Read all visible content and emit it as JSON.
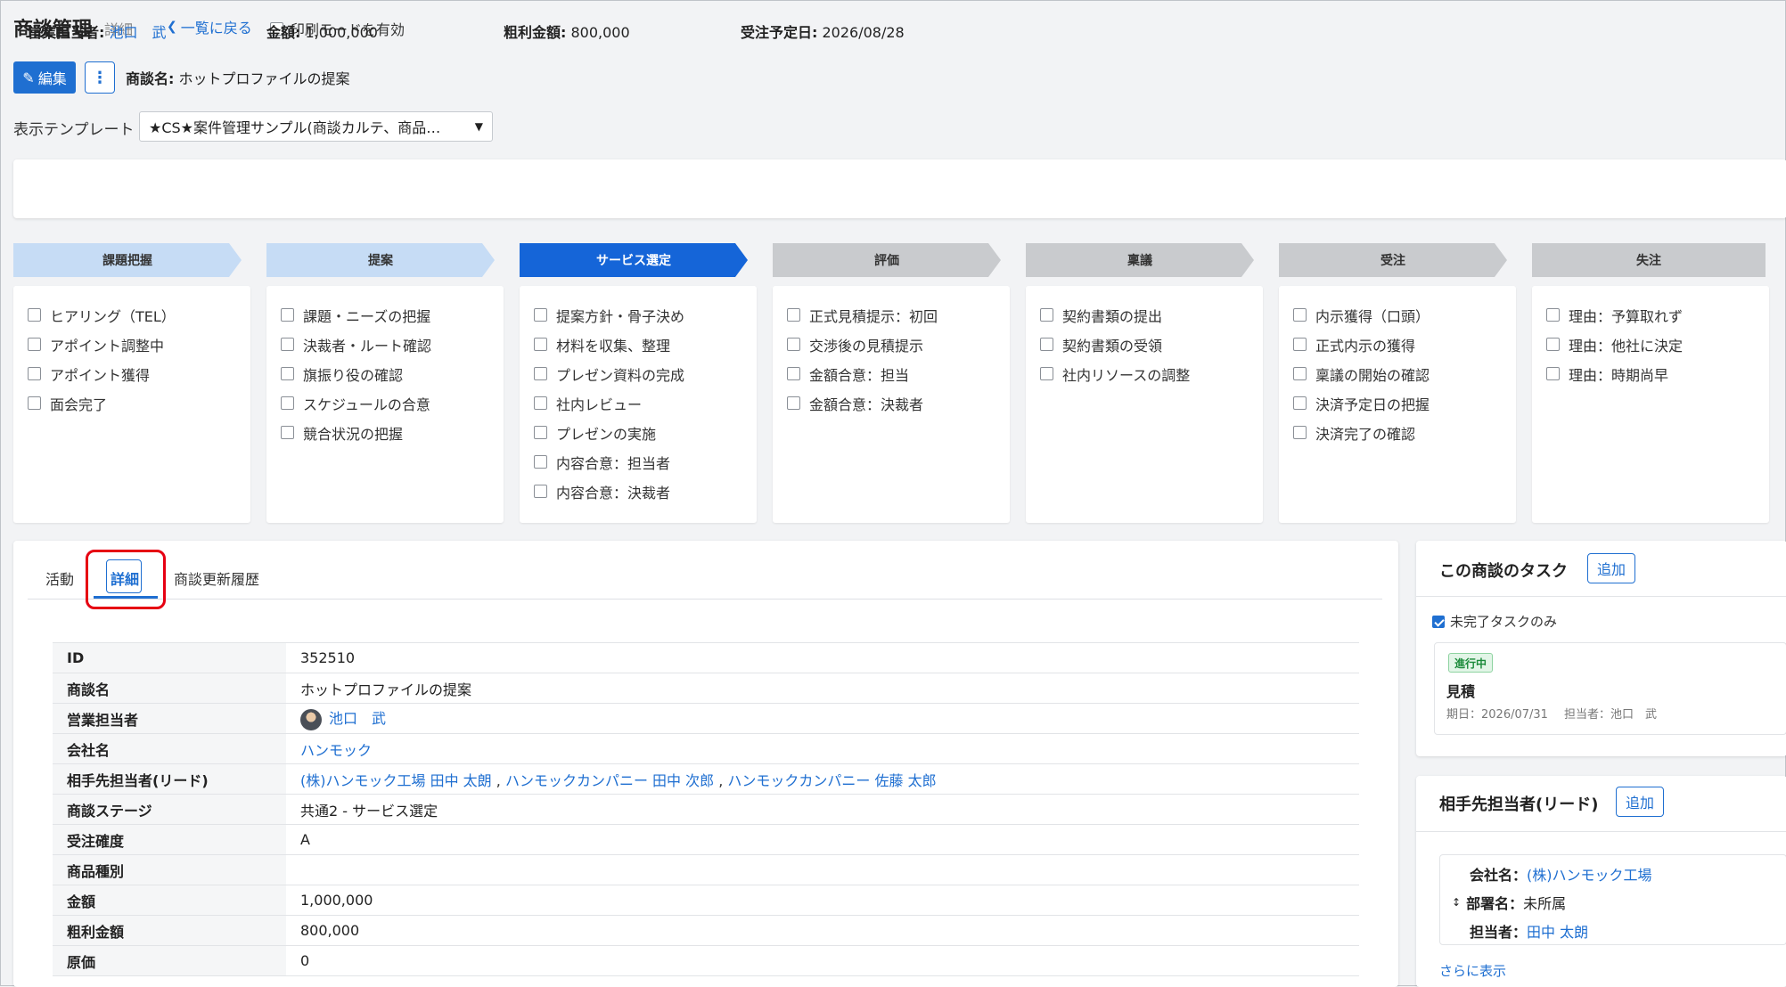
{
  "header": {
    "title": "商談管理",
    "subtitle": "詳細",
    "back_link": "一覧に戻る",
    "print_mode_label": "印刷モードを有効"
  },
  "toolbar": {
    "edit_label": "編集",
    "deal_name_label": "商談名:",
    "deal_name_value": "ホットプロファイルの提案"
  },
  "template": {
    "label": "表示テンプレート",
    "selected": "★CS★案件管理サンプル(商談カルテ、商品…"
  },
  "summary": [
    {
      "label": "営業担当者:",
      "value": "池口　武",
      "link": true
    },
    {
      "label": "金額:",
      "value": "1,000,000",
      "link": false
    },
    {
      "label": "粗利金額:",
      "value": "800,000",
      "link": false
    },
    {
      "label": "受注予定日:",
      "value": "2026/08/28",
      "link": false
    }
  ],
  "stages": [
    {
      "name": "課題把握",
      "status": "done",
      "tasks": [
        "ヒアリング（TEL）",
        "アポイント調整中",
        "アポイント獲得",
        "面会完了"
      ]
    },
    {
      "name": "提案",
      "status": "done",
      "tasks": [
        "課題・ニーズの把握",
        "決裁者・ルート確認",
        "旗振り役の確認",
        "スケジュールの合意",
        "競合状況の把握"
      ]
    },
    {
      "name": "サービス選定",
      "status": "current",
      "tasks": [
        "提案方針・骨子決め",
        "材料を収集、整理",
        "プレゼン資料の完成",
        "社内レビュー",
        "プレゼンの実施",
        "内容合意：担当者",
        "内容合意：決裁者"
      ]
    },
    {
      "name": "評価",
      "status": "future",
      "tasks": [
        "正式見積提示：初回",
        "交渉後の見積提示",
        "金額合意：担当",
        "金額合意：決裁者"
      ]
    },
    {
      "name": "稟議",
      "status": "future",
      "tasks": [
        "契約書類の提出",
        "契約書類の受領",
        "社内リソースの調整"
      ]
    },
    {
      "name": "受注",
      "status": "future",
      "tasks": [
        "内示獲得（口頭）",
        "正式内示の獲得",
        "稟議の開始の確認",
        "決済予定日の把握",
        "決済完了の確認"
      ]
    },
    {
      "name": "失注",
      "status": "future",
      "tasks": [
        "理由：予算取れず",
        "理由：他社に決定",
        "理由：時期尚早"
      ]
    }
  ],
  "tabs": [
    {
      "label": "活動"
    },
    {
      "label": "詳細"
    },
    {
      "label": "商談更新履歴"
    }
  ],
  "details": [
    {
      "key": "ID",
      "value": "352510"
    },
    {
      "key": "商談名",
      "value": "ホットプロファイルの提案"
    },
    {
      "key": "営業担当者",
      "value": "池口　武"
    },
    {
      "key": "会社名",
      "value": "ハンモック"
    },
    {
      "key": "相手先担当者(リード)",
      "links": [
        "(株)ハンモック工場 田中 太朗",
        "ハンモックカンパニー 田中 次郎",
        "ハンモックカンパニー 佐藤 太郎"
      ]
    },
    {
      "key": "商談ステージ",
      "value": "共通2 - サービス選定"
    },
    {
      "key": "受注確度",
      "value": "A"
    },
    {
      "key": "商品種別",
      "value": ""
    },
    {
      "key": "金額",
      "value": "1,000,000"
    },
    {
      "key": "粗利金額",
      "value": "800,000"
    },
    {
      "key": "原価",
      "value": "0"
    }
  ],
  "tasks_card": {
    "title": "この商談のタスク",
    "add_label": "追加",
    "filter_label": "未完了タスクのみ",
    "item": {
      "badge": "進行中",
      "name": "見積",
      "due": "期日：2026/07/31",
      "assignee": "担当者：池口　武"
    }
  },
  "contact_card": {
    "title": "相手先担当者(リード)",
    "add_label": "追加",
    "company_label": "会社名：",
    "company_value": "(株)ハンモック工場",
    "dept_label": "部署名：",
    "dept_value": "未所属",
    "person_label": "担当者：",
    "person_value": "田中 太朗",
    "more_label": "さらに表示"
  },
  "colors": {
    "accent": "#1f6fd1",
    "stage_current": "#1565d8",
    "stage_done": "#c6dcf5",
    "stage_future": "#c9cbce",
    "highlight": "#e60012"
  }
}
